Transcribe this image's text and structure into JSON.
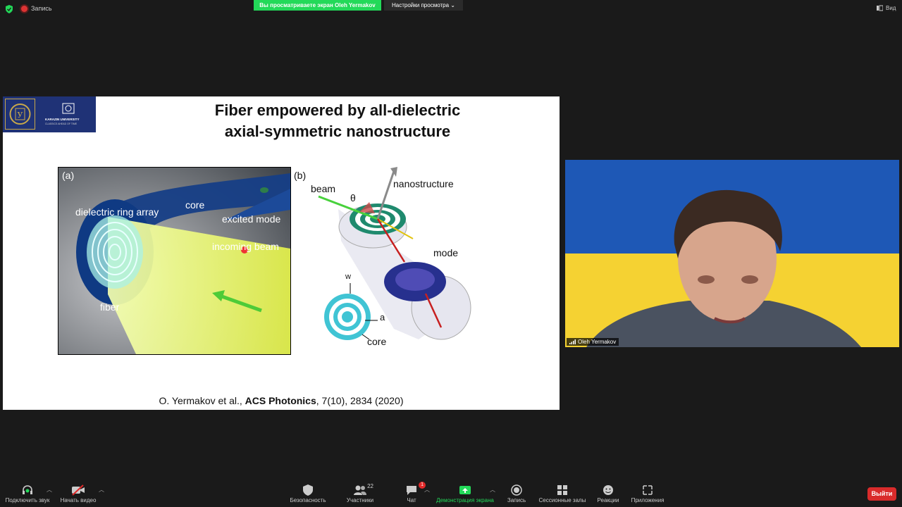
{
  "topbar": {
    "recording_label": "Запись",
    "share_banner": "Вы просматриваете экран Oleh Yermakov",
    "view_options": "Настройки просмотра",
    "view_button": "Вид",
    "icons": [
      "shield-check-icon",
      "recording-dot-icon",
      "chevron-down-icon",
      "view-icon"
    ]
  },
  "slide": {
    "logo_text": "KARAZIN UNIVERSITY",
    "logo_subtext": "CLASSICS AHEAD OF TIME",
    "title_line1": "Fiber empowered by all-dielectric",
    "title_line2": "axial-symmetric nanostructure",
    "fig_a": {
      "panel_label": "(a)",
      "labels": {
        "core": "core",
        "ring_array": "dielectric ring array",
        "excited_mode": "excited mode",
        "incoming_beam": "incoming beam",
        "fiber": "fiber"
      }
    },
    "fig_b": {
      "panel_label": "(b)",
      "labels": {
        "beam": "beam",
        "theta": "θ",
        "nanostructure": "nanostructure",
        "mode": "mode",
        "w": "w",
        "a": "a",
        "core": "core"
      }
    },
    "citation_authors": "O. Yermakov et al., ",
    "citation_journal": "ACS Photonics",
    "citation_ref": ", 7(10), 2834 (2020)"
  },
  "video": {
    "participant_name": "Oleh Yermakov",
    "background_colors": {
      "top": "#1e58b6",
      "bottom": "#f5d232"
    }
  },
  "toolbar": {
    "audio": "Подключить звук",
    "video": "Начать видео",
    "security": "Безопасность",
    "participants": "Участники",
    "participants_count": "22",
    "chat": "Чат",
    "chat_badge": "1",
    "share": "Демонстрация экрана",
    "record": "Запись",
    "breakout": "Сессионные залы",
    "reactions": "Реакции",
    "apps": "Приложения",
    "leave": "Выйти"
  },
  "colors": {
    "share_green": "#23d959",
    "leave_red": "#d92b2b",
    "app_background": "#1a1a1a"
  }
}
